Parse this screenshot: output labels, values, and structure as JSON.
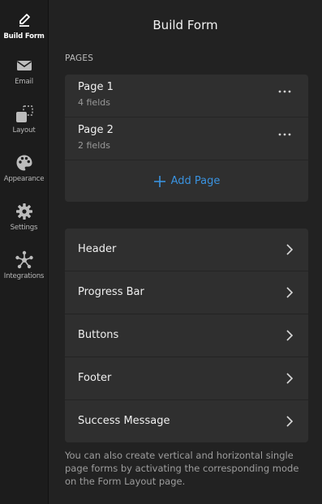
{
  "rail": {
    "items": [
      {
        "label": "Build Form",
        "icon": "pen-icon",
        "active": true
      },
      {
        "label": "Email",
        "icon": "envelope-icon",
        "active": false
      },
      {
        "label": "Layout",
        "icon": "layout-icon",
        "active": false
      },
      {
        "label": "Appearance",
        "icon": "palette-icon",
        "active": false
      },
      {
        "label": "Settings",
        "icon": "gear-icon",
        "active": false
      },
      {
        "label": "Integrations",
        "icon": "integrations-icon",
        "active": false
      }
    ]
  },
  "header": {
    "title": "Build Form"
  },
  "pages": {
    "section_label": "PAGES",
    "items": [
      {
        "name": "Page 1",
        "fields": "4 fields"
      },
      {
        "name": "Page 2",
        "fields": "2 fields"
      }
    ],
    "add_label": "Add Page"
  },
  "settings": {
    "items": [
      {
        "label": "Header"
      },
      {
        "label": "Progress Bar"
      },
      {
        "label": "Buttons"
      },
      {
        "label": "Footer"
      },
      {
        "label": "Success Message"
      }
    ]
  },
  "note": "You can also create vertical and horizontal single page forms by activating the corresponding mode on the Form Layout page.",
  "colors": {
    "accent": "#3a93e0",
    "background": "#222222",
    "card": "#2f2f2f",
    "rail": "#1c1c1c"
  }
}
